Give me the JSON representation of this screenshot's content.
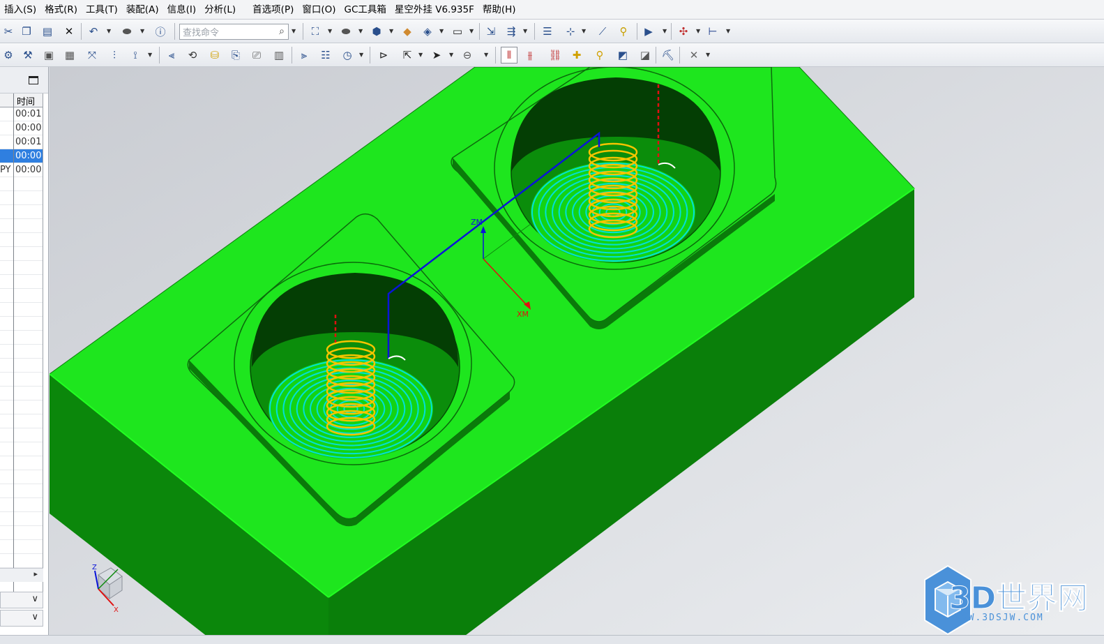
{
  "menubar": {
    "items": [
      "插入(S)",
      "格式(R)",
      "工具(T)",
      "装配(A)",
      "信息(I)",
      "分析(L)",
      "首选项(P)",
      "窗口(O)",
      "GC工具箱",
      "星空外挂 V6.935F",
      "帮助(H)"
    ]
  },
  "toolbar": {
    "search_placeholder": "查找命令"
  },
  "navigator": {
    "column_time": "时间",
    "rows": [
      {
        "name": "",
        "time": "00:01"
      },
      {
        "name": "",
        "time": "00:00"
      },
      {
        "name": "",
        "time": "00:01"
      },
      {
        "name": "",
        "time": "00:00",
        "selected": true
      },
      {
        "name": "PY",
        "time": "00:00"
      }
    ]
  },
  "viewport": {
    "wcs_z_label": "ZM",
    "wcs_x_label": "XM",
    "triad_x": "X",
    "triad_y": "Y",
    "triad_z": "Z"
  },
  "watermark": {
    "brand": "3D世界网",
    "url": "WWW.3DSJW.COM"
  },
  "colors": {
    "part_top": "#1ee61e",
    "part_side": "#0b8a0b",
    "toolpath_cut": "#00e0d8",
    "toolpath_helix": "#f5c400",
    "toolpath_link": "#0a14d8",
    "viewport_bg": "#d7dadf"
  }
}
